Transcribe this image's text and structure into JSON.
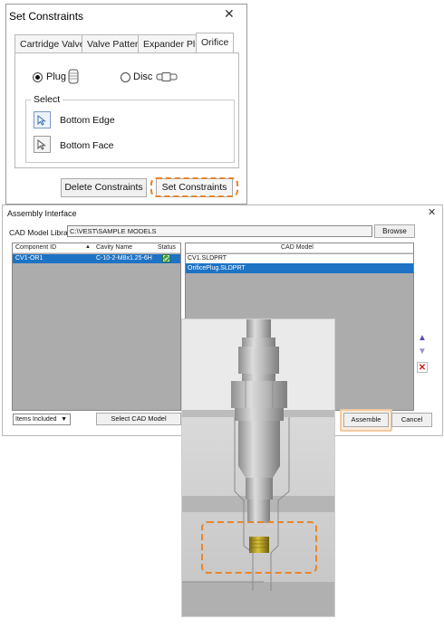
{
  "set_constraints": {
    "title": "Set Constraints",
    "close_glyph": "✕",
    "tabs": [
      "Cartridge Valve",
      "Valve Pattern",
      "Expander Plug",
      "Orifice"
    ],
    "active_tab": "Orifice",
    "radio_plug": "Plug",
    "radio_disc": "Disc",
    "selected_option": "Plug",
    "select_group_label": "Select",
    "select_items": [
      "Bottom Edge",
      "Bottom Face"
    ],
    "delete_button": "Delete Constraints",
    "set_button": "Set Constraints",
    "highlight_color": "#e8862b"
  },
  "assembly_interface": {
    "title": "Assembly Interface",
    "close_glyph": "✕",
    "library_label": "CAD Model Library",
    "library_path": "C:\\VEST\\SAMPLE MODELS",
    "browse_button": "Browse",
    "component_columns": [
      "Component ID",
      "Cavity Name",
      "Status"
    ],
    "component_rows": [
      {
        "component_id": "CV1-OR1",
        "cavity_name": "C-10-2-M8x1.25-6H",
        "status": "ok"
      }
    ],
    "cad_model_header": "CAD Model",
    "cad_models": [
      "CV1.SLDPRT",
      "OrificePlug.SLDPRT"
    ],
    "selected_cad_model": "OrificePlug.SLDPRT",
    "items_dropdown": "Items Included",
    "select_cad_button": "Select CAD Model",
    "assemble_button": "Assemble",
    "cancel_button": "Cancel",
    "selection_color": "#1e73c4"
  },
  "icons": {
    "move_up": "arrow-up-icon",
    "move_down": "arrow-down-icon",
    "remove": "red-x-icon",
    "pointer": "cursor-pointer-icon"
  }
}
